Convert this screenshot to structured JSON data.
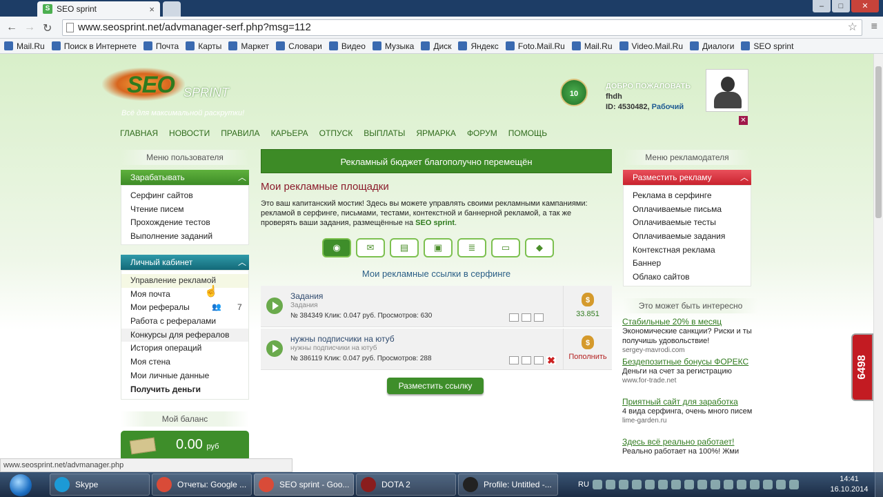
{
  "browser": {
    "tab_title": "SEO sprint",
    "tab_close": "×",
    "url": "www.seosprint.net/advmanager-serf.php?msg=112",
    "bookmarks": [
      "Mail.Ru",
      "Поиск в Интернете",
      "Почта",
      "Карты",
      "Маркет",
      "Словари",
      "Видео",
      "Музыка",
      "Диск",
      "Яндекс",
      "Foto.Mail.Ru",
      "Mail.Ru",
      "Video.Mail.Ru",
      "Диалоги",
      "SEO sprint"
    ],
    "status_url": "www.seosprint.net/advmanager.php"
  },
  "header": {
    "logo_seo": "SEO",
    "logo_sprint": "SPRINT",
    "slogan": "Всё для максимальной раскрутки!",
    "level": "10",
    "welcome": "ДОБРО ПОЖАЛОВАТЬ",
    "username": "fhdh",
    "user_id": "ID: 4530482,",
    "user_status": "Рабочий",
    "nav": [
      "ГЛАВНАЯ",
      "НОВОСТИ",
      "ПРАВИЛА",
      "КАРЬЕРА",
      "ОТПУСК",
      "ВЫПЛАТЫ",
      "ЯРМАРКА",
      "ФОРУМ",
      "ПОМОЩЬ"
    ]
  },
  "left": {
    "user_menu_title": "Меню пользователя",
    "earn_title": "Зарабатывать",
    "earn_items": [
      "Серфинг сайтов",
      "Чтение писем",
      "Прохождение тестов",
      "Выполнение заданий"
    ],
    "cabinet_title": "Личный кабинет",
    "cabinet_items": [
      "Управление рекламой",
      "Моя почта",
      "Мои рефералы",
      "Работа с рефералами",
      "Конкурсы для рефералов",
      "История операций",
      "Моя стена",
      "Мои личные данные",
      "Получить деньги"
    ],
    "referrals_count": "7",
    "balance_title": "Мой баланс",
    "balance_amount": "0.00",
    "balance_currency": "руб"
  },
  "center": {
    "notice": "Рекламный бюджет благополучно перемещён",
    "title": "Мои рекламные площадки",
    "desc_text": "Это ваш капитанский мостик! Здесь вы можете управлять своими рекламными кампаниями: рекламой в серфинге, письмами, тестами, контекстной и баннерной рекламой, а так же проверять ваши задания, размещённые на",
    "desc_brand": "SEO sprint",
    "desc_end": ".",
    "surf_title": "Мои рекламные ссылки в серфинге",
    "rows": [
      {
        "name": "Задания",
        "sub": "Задания",
        "meta": "№ 384349   Клик: 0.047 руб.   Просмотров: 630",
        "money": "33.851"
      },
      {
        "name": "нужны подписчики на ютуб",
        "sub": "нужны подписчики на ютуб",
        "meta": "№ 386119   Клик: 0.047 руб.   Просмотров: 288",
        "money": "Пополнить"
      }
    ],
    "place_link": "Разместить ссылку"
  },
  "right": {
    "adv_menu_title": "Меню рекламодателя",
    "place_title": "Разместить рекламу",
    "place_items": [
      "Реклама в серфинге",
      "Оплачиваемые письма",
      "Оплачиваемые тесты",
      "Оплачиваемые задания",
      "Контекстная реклама",
      "Баннер",
      "Облако сайтов"
    ],
    "interest_title": "Это может быть интересно",
    "ads": [
      {
        "title": "Стабильные 20% в месяц",
        "text": "Экономические санкции? Риски и ты получишь удовольствие!",
        "url": "sergey-mavrodi.com"
      },
      {
        "title": "Бездепозитные бонусы ФОРЕКС",
        "text": "Деньги на счет за регистрацию",
        "url": "www.for-trade.net"
      },
      {
        "title": "Приятный сайт для заработка",
        "text": "4 вида серфинга, очень много писем",
        "url": "lime-garden.ru"
      },
      {
        "title": "Здесь всё реально работает!",
        "text": "Реально работает на 100%! Жми",
        "url": ""
      }
    ],
    "widget_count": "6498"
  },
  "taskbar": {
    "items": [
      "Skype",
      "Отчеты: Google ...",
      "SEO sprint - Goo...",
      "DOTA 2",
      "Profile: Untitled -..."
    ],
    "lang": "RU",
    "time": "14:41",
    "date": "16.10.2014"
  },
  "colors": {
    "green": "#3e8e2a",
    "red": "#d9323f",
    "teal": "#1f7a8c"
  }
}
